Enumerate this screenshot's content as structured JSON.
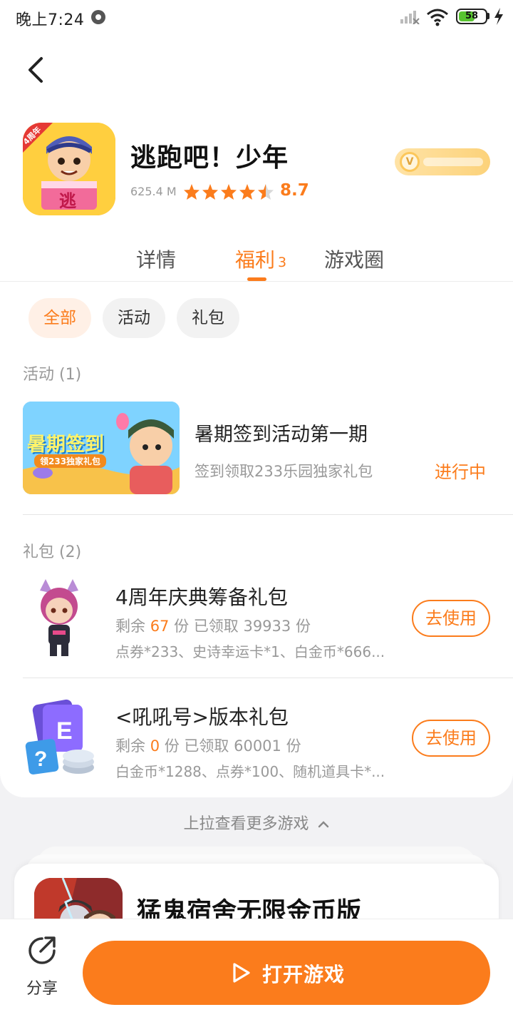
{
  "status_bar": {
    "time": "晚上7:24",
    "battery": "58"
  },
  "app": {
    "name": "逃跑吧！少年",
    "size": "625.4 M",
    "rating": "8.7",
    "rating_stars": 4.5,
    "icon_badge": "4周年",
    "icon_glyph": "逃"
  },
  "tabs": [
    {
      "label": "详情"
    },
    {
      "label": "福利",
      "count": "3"
    },
    {
      "label": "游戏圈"
    }
  ],
  "filters": [
    "全部",
    "活动",
    "礼包"
  ],
  "events": {
    "header": "活动 (1)",
    "items": [
      {
        "title": "暑期签到活动第一期",
        "desc": "签到领取233乐园独家礼包",
        "status": "进行中",
        "banner_text": "暑期签到",
        "banner_sub": "领233独家礼包"
      }
    ]
  },
  "gifts": {
    "header": "礼包 (2)",
    "items": [
      {
        "title": "4周年庆典筹备礼包",
        "stock_prefix": "剩余",
        "remaining": "67",
        "stock_suffix": "份 已领取 39933 份",
        "contents": "点券*233、史诗幸运卡*1、白金币*666...",
        "button": "去使用"
      },
      {
        "title": "<吼吼号>版本礼包",
        "stock_prefix": "剩余",
        "remaining": "0",
        "stock_suffix": "份 已领取 60001 份",
        "contents": "白金币*1288、点券*100、随机道具卡*...",
        "button": "去使用"
      }
    ]
  },
  "more_hint": "上拉查看更多游戏",
  "next_game": {
    "title": "猛鬼宿舍无限金币版"
  },
  "bottom": {
    "share_label": "分享",
    "open_label": "打开游戏"
  },
  "colors": {
    "accent": "#fb7c1c",
    "chip_active_bg": "#fff0e6",
    "muted_text": "#999999"
  }
}
